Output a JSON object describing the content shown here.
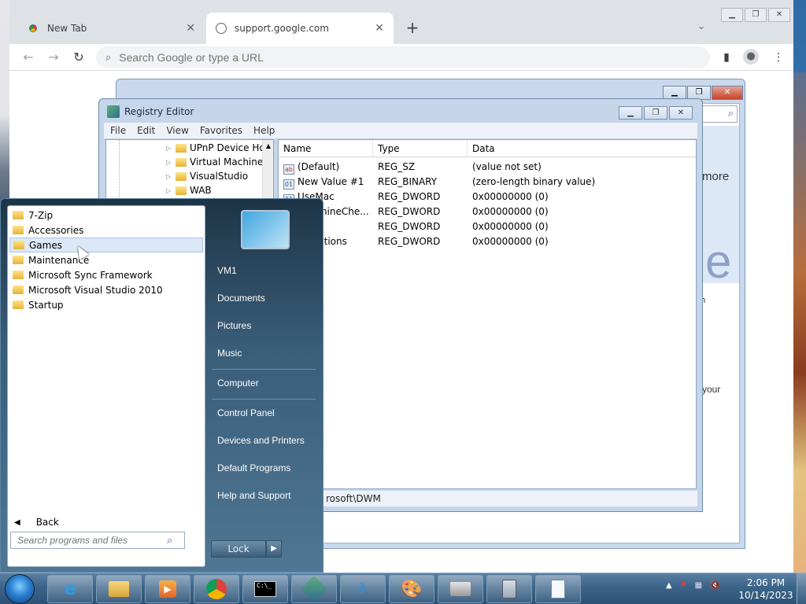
{
  "browser": {
    "tabs": [
      {
        "label": "New Tab",
        "icon": "chrome-icon"
      },
      {
        "label": "support.google.com",
        "icon": "globe-icon"
      }
    ],
    "omnibox_placeholder": "Search Google or type a URL",
    "page_text": {
      "more": "more",
      "big_e": "e",
      "your": "your",
      "h": "h"
    }
  },
  "registry": {
    "title": "Registry Editor",
    "menu": [
      "File",
      "Edit",
      "View",
      "Favorites",
      "Help"
    ],
    "tree": [
      "UPnP Device Ho",
      "Virtual Machine",
      "VisualStudio",
      "WAB"
    ],
    "columns": [
      "Name",
      "Type",
      "Data"
    ],
    "rows": [
      {
        "name": "(Default)",
        "type": "REG_SZ",
        "data": "(value not set)",
        "icon": "ab"
      },
      {
        "name": "New Value #1",
        "type": "REG_BINARY",
        "data": "(zero-length binary value)",
        "icon": "bin"
      },
      {
        "name": "UseMac",
        "type": "REG_DWORD",
        "data": "0x00000000 (0)",
        "icon": "bin"
      },
      {
        "name": "achineChe...",
        "type": "REG_DWORD",
        "data": "0x00000000 (0)",
        "icon": "bin"
      },
      {
        "name": "",
        "type": "REG_DWORD",
        "data": "0x00000000 (0)",
        "icon": "bin"
      },
      {
        "name": "ptions",
        "type": "REG_DWORD",
        "data": "0x00000000 (0)",
        "icon": "bin"
      }
    ],
    "status": "rosoft\\DWM"
  },
  "startmenu": {
    "programs": [
      "7-Zip",
      "Accessories",
      "Games",
      "Maintenance",
      "Microsoft Sync Framework",
      "Microsoft Visual Studio 2010",
      "Startup"
    ],
    "back_label": "Back",
    "search_placeholder": "Search programs and files",
    "right_items": [
      "VM1",
      "Documents",
      "Pictures",
      "Music",
      "Computer",
      "Control Panel",
      "Devices and Printers",
      "Default Programs",
      "Help and Support"
    ],
    "lock_label": "Lock"
  },
  "taskbar": {
    "time": "2:06 PM",
    "date": "10/14/2023",
    "apps": [
      "ie-icon",
      "explorer-icon",
      "media-player-icon",
      "chrome-icon",
      "cmd-icon",
      "regedit-icon",
      "vs-icon",
      "paint-icon",
      "fax-icon",
      "calculator-icon",
      "notepad-icon"
    ]
  }
}
